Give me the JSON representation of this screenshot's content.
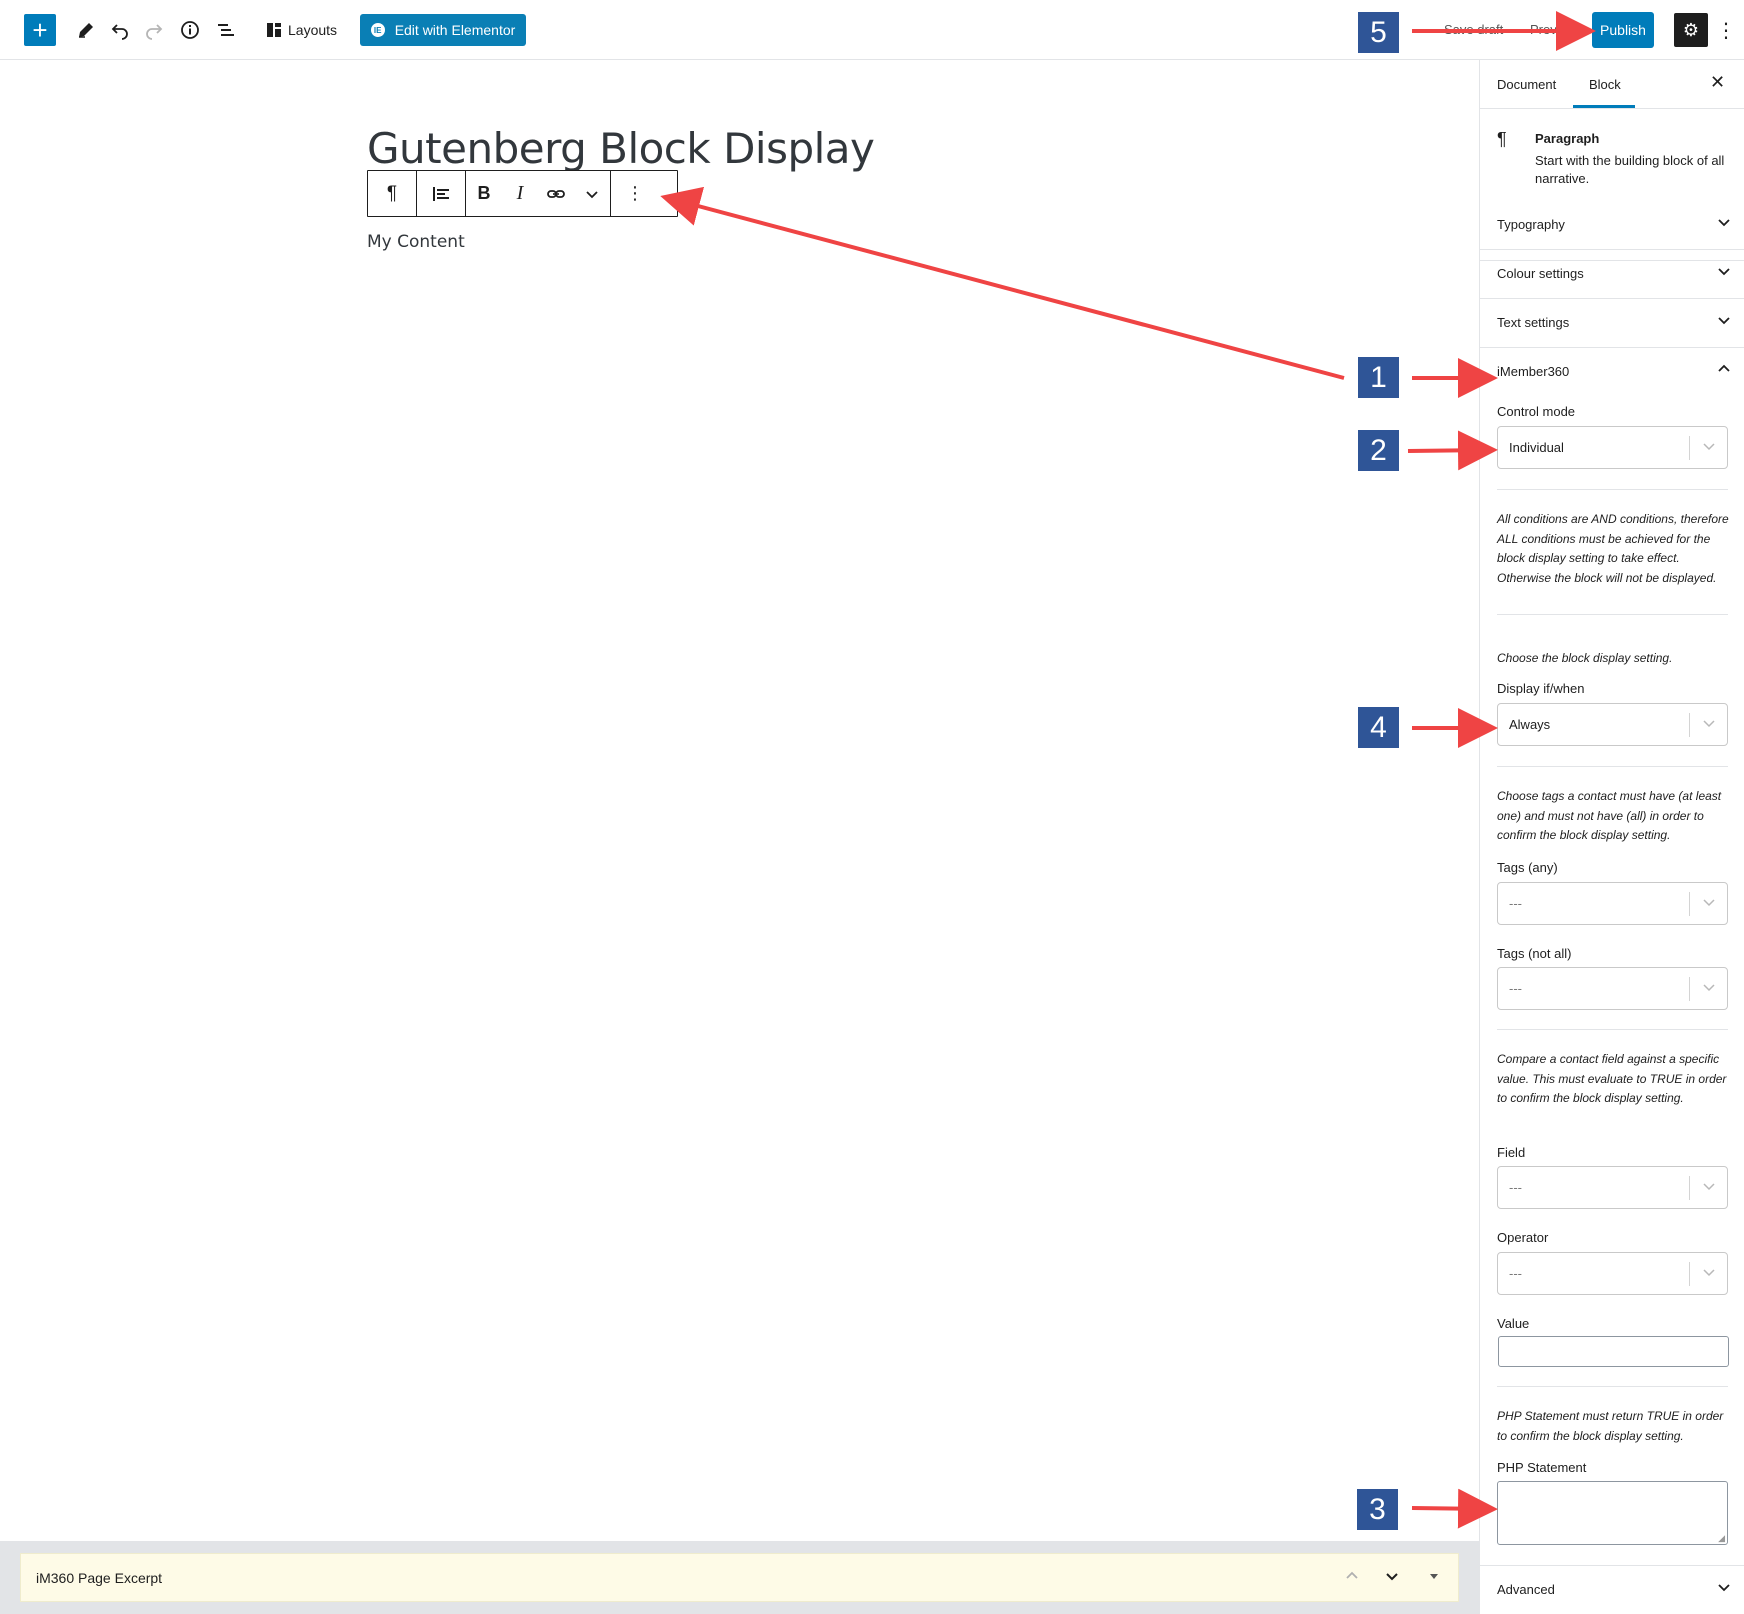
{
  "topbar": {
    "layouts_label": "Layouts",
    "elementor_label": "Edit with Elementor",
    "save_draft_label": "Save draft",
    "preview_label": "Preview",
    "publish_label": "Publish"
  },
  "editor": {
    "post_title": "Gutenberg Block Display",
    "paragraph": "My Content"
  },
  "sidebar": {
    "tabs": [
      "Document",
      "Block"
    ],
    "active_tab": "Block",
    "block_card": {
      "title": "Paragraph",
      "description": "Start with the building block of all narrative."
    },
    "panels": {
      "typography": "Typography",
      "colour": "Colour settings",
      "text": "Text settings",
      "imember": "iMember360",
      "advanced": "Advanced"
    },
    "imember": {
      "control_mode_label": "Control mode",
      "control_mode_value": "Individual",
      "and_help": "All conditions are AND conditions, therefore ALL conditions must be achieved for the block display setting to take effect. Otherwise the block will not be displayed.",
      "display_help": "Choose the block display setting.",
      "display_label": "Display if/when",
      "display_value": "Always",
      "tags_help": "Choose tags a contact must have (at least one) and must not have (all) in order to confirm the block display setting.",
      "tags_any_label": "Tags (any)",
      "tags_any_value": "---",
      "tags_not_all_label": "Tags (not all)",
      "tags_not_all_value": "---",
      "compare_help": "Compare a contact field against a specific value. This must evaluate to TRUE in order to confirm the block display setting.",
      "field_label": "Field",
      "field_value": "---",
      "operator_label": "Operator",
      "operator_value": "---",
      "value_label": "Value",
      "php_help": "PHP Statement must return TRUE in order to confirm the block display setting.",
      "php_label": "PHP Statement"
    }
  },
  "metabox": {
    "title": "iM360 Page Excerpt"
  },
  "annotations": {
    "markers": [
      "1",
      "2",
      "3",
      "4",
      "5"
    ],
    "color": "#2f5597",
    "arrow_color": "#ef4444"
  },
  "colors": {
    "accent": "#007cba",
    "metabox_bg": "#fefbe7"
  }
}
